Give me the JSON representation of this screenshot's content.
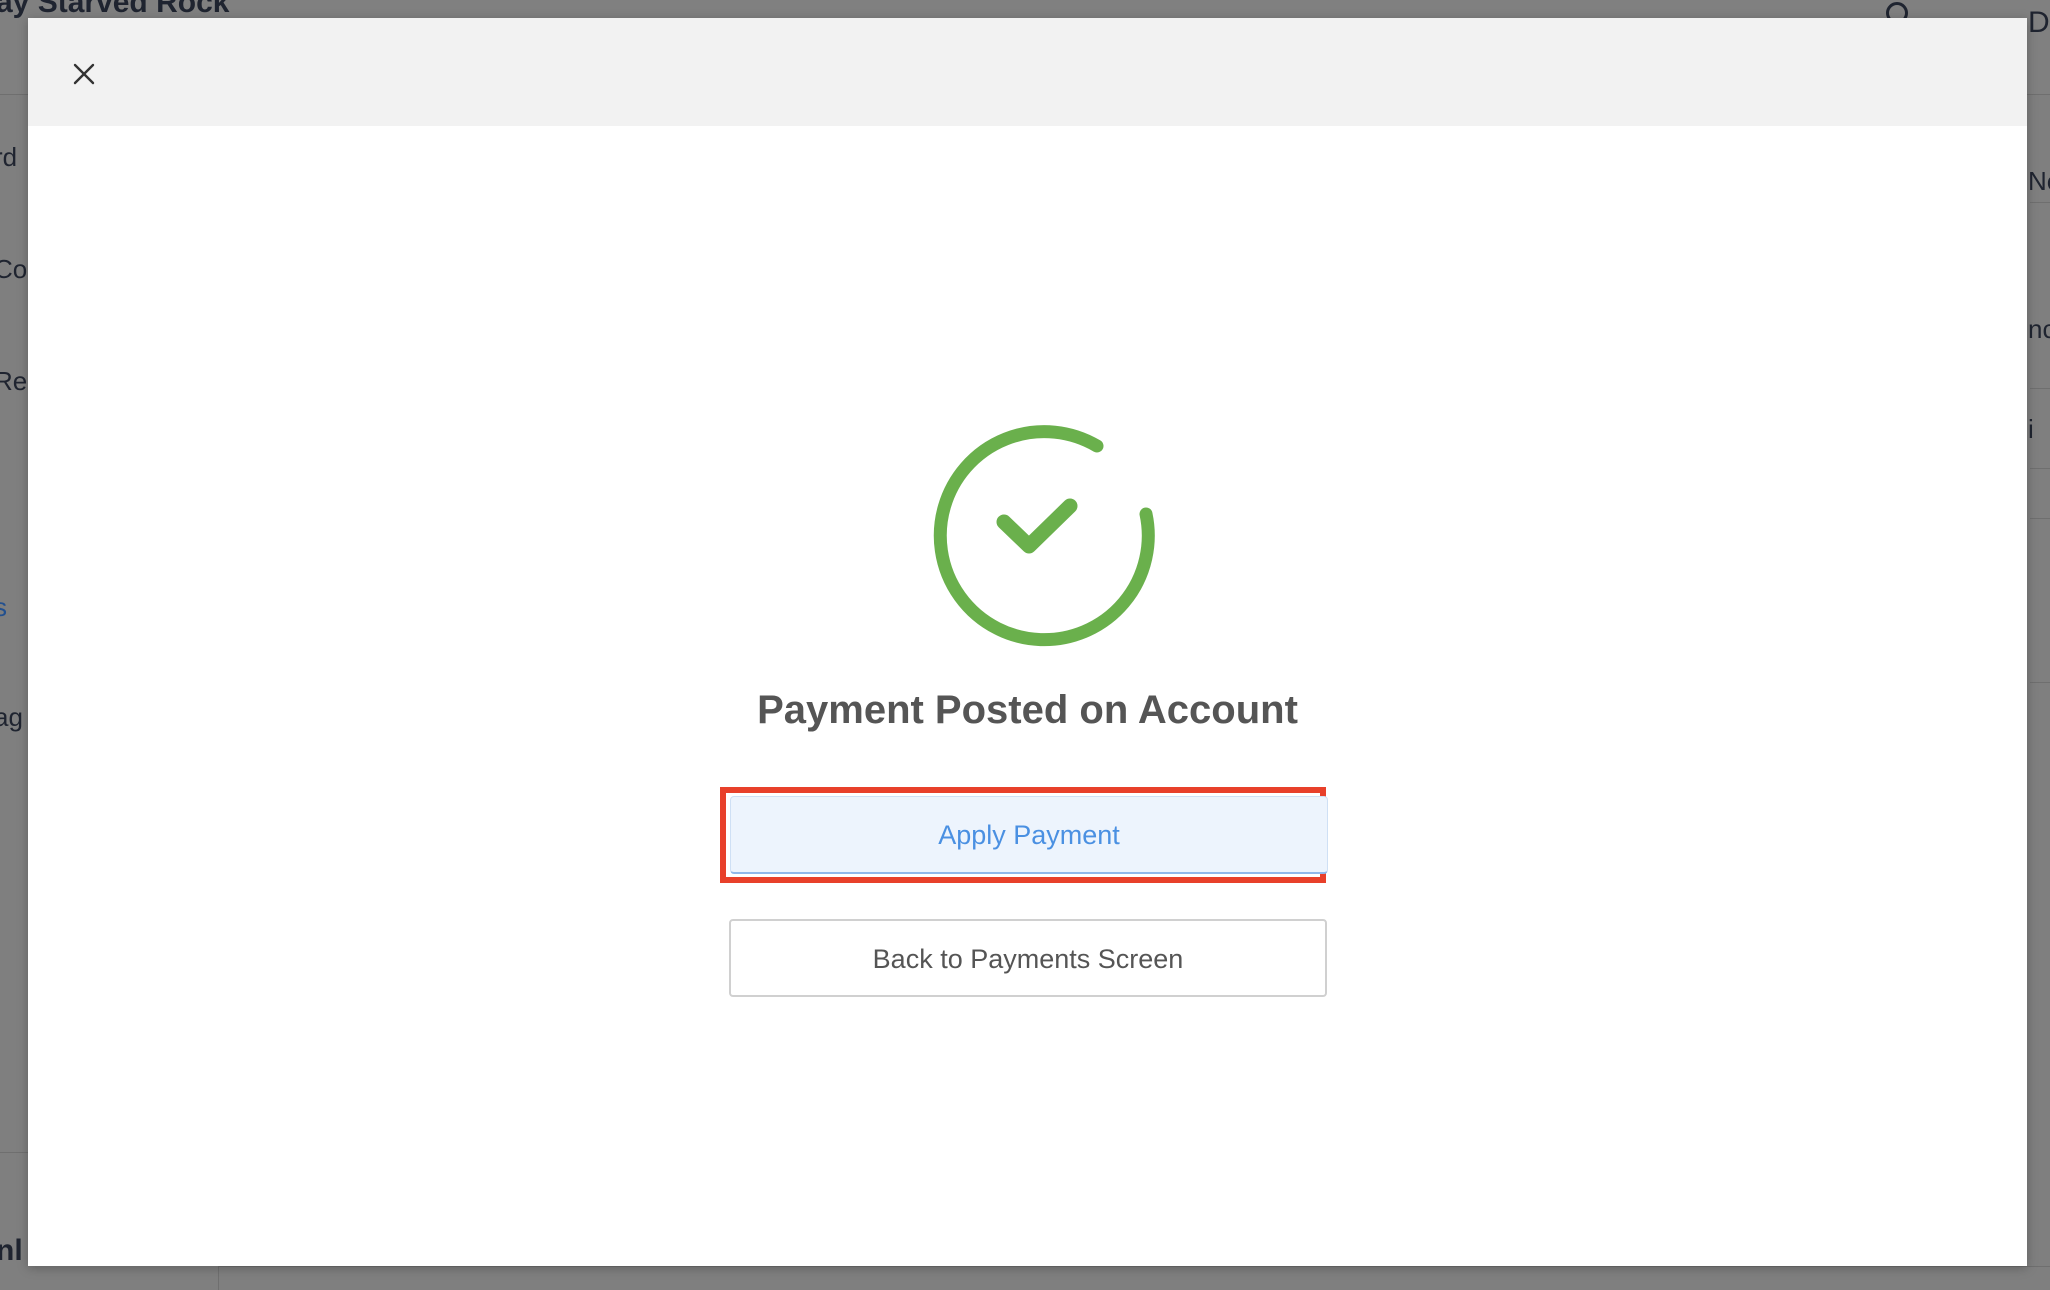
{
  "background": {
    "hotel_name": "ay Starved Rock",
    "user_initial": "D",
    "sidebar_items": [
      "rd",
      "Co",
      "Re",
      "s",
      "ag"
    ],
    "bottom_label": "nl",
    "right_fragments": [
      "Ne",
      "nc",
      "i"
    ]
  },
  "modal": {
    "close_icon": "close-icon",
    "status_icon": "check-circle-icon",
    "status_color": "#6ab04c",
    "title": "Payment Posted on Account",
    "primary_button": "Apply Payment",
    "secondary_button": "Back to Payments Screen",
    "highlight_color": "#e8402a"
  }
}
